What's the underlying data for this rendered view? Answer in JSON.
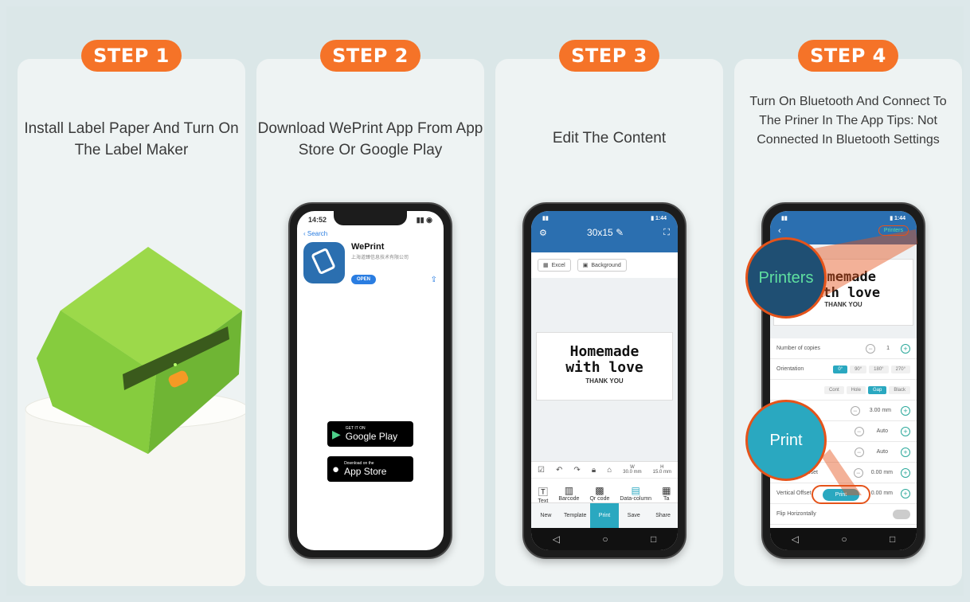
{
  "steps": [
    {
      "badge": "STEP 1",
      "title": "Install Label Paper And Turn On The Label Maker"
    },
    {
      "badge": "STEP 2",
      "title": "Download WePrint App From App Store Or Google Play"
    },
    {
      "badge": "STEP 3",
      "title": "Edit The Content"
    },
    {
      "badge": "STEP 4",
      "title": "Turn On Bluetooth And Connect To The Priner In The App Tips: Not Connected In Bluetooth Settings"
    }
  ],
  "phone2": {
    "time": "14:52",
    "back": "Search",
    "app_name": "WePrint",
    "app_dev": "上海道臻信息技术有限公司",
    "open": "OPEN",
    "google_small": "GET IT ON",
    "google_big": "Google Play",
    "apple_small": "Download on the",
    "apple_big": "App Store"
  },
  "phone3": {
    "size": "30x15",
    "excel": "Excel",
    "background": "Background",
    "label_line1": "Homemade",
    "label_line2": "with love",
    "label_line3": "THANK YOU",
    "w": "W",
    "h": "H",
    "w_val": "30.0 mm",
    "h_val": "15.0 mm",
    "tools": [
      "Text",
      "Barcode",
      "Qr code",
      "Data-column",
      "Ta"
    ],
    "bottom": [
      "New",
      "Template",
      "Print",
      "Save",
      "Share"
    ]
  },
  "phone4": {
    "printers": "Printers",
    "label_line1": "Homemade",
    "label_line2": "with love",
    "label_line3": "THANK YOU",
    "callout_printers": "Printers",
    "callout_print": "Print",
    "copies_label": "Number of copies",
    "copies_val": "1",
    "orientation": "Orientation",
    "orient_opts": [
      "0°",
      "90°",
      "180°",
      "270°"
    ],
    "paper_opts": [
      "Cont",
      "Hole",
      "Gap",
      "Black"
    ],
    "gap_val": "3.00 mm",
    "auto1": "Auto",
    "auto2": "Auto",
    "hoff": "Horizontal Offset",
    "hoff_val": "0.00 mm",
    "voff": "Vertical Offset",
    "voff_val": "0.00 mm",
    "print_btn": "Print",
    "flip": "Flip Horizontally"
  }
}
